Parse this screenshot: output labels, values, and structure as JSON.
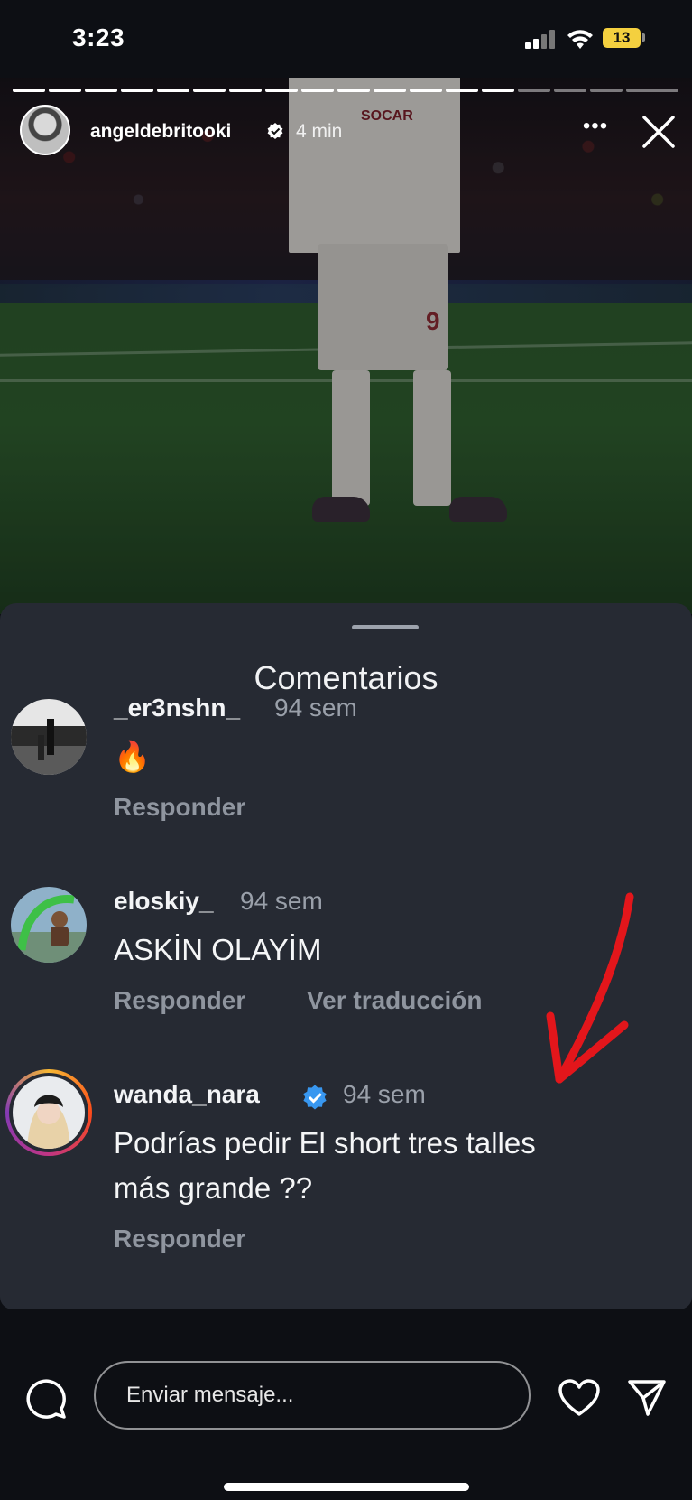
{
  "status_bar": {
    "time": "3:23",
    "battery": "13"
  },
  "story": {
    "username": "angeldebritooki",
    "time_ago": "4 min",
    "more_label": "•••",
    "image": {
      "sponsor": "SOCAR",
      "shirt_number": "9"
    }
  },
  "comments_sheet": {
    "title": "Comentarios",
    "comments": [
      {
        "username": "_er3nshn_",
        "time": "94 sem",
        "text": "🔥",
        "reply_label": "Responder"
      },
      {
        "username": "eloskiy_",
        "time": "94 sem",
        "text": "ASKİN OLAYİM",
        "reply_label": "Responder",
        "translate_label": "Ver traducción"
      },
      {
        "username": "wanda_nara",
        "verified": true,
        "time": "94 sem",
        "text_line1": "Podrías pedir El short tres talles",
        "text_line2": "más grande ??",
        "reply_label": "Responder"
      }
    ]
  },
  "annotation": {
    "arrow_color": "#e3161b"
  },
  "bottom_bar": {
    "message_placeholder": "Enviar mensaje..."
  },
  "colors": {
    "verified": "#3897f0",
    "sheet_bg": "#262a33"
  },
  "icons": [
    "close-icon",
    "more-icon",
    "comment-icon",
    "heart-icon",
    "send-icon",
    "verified-badge-icon"
  ]
}
